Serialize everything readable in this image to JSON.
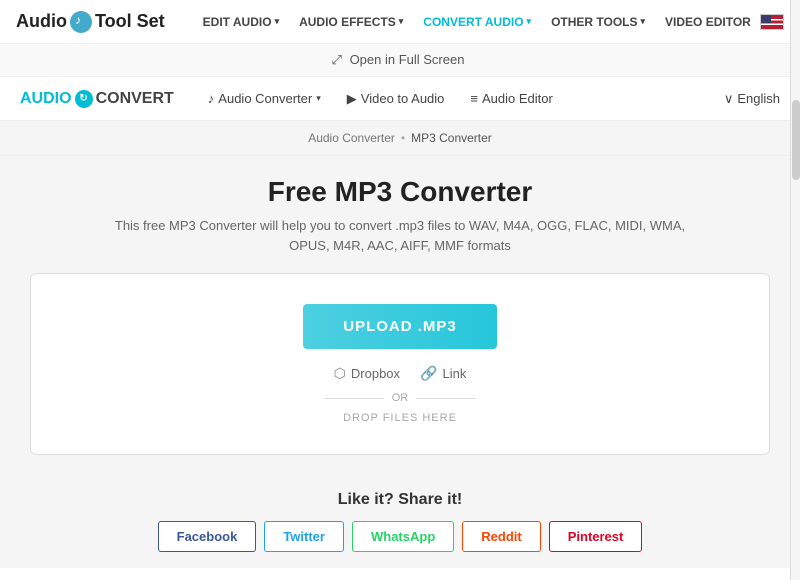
{
  "topNav": {
    "logo": "Audio Tool Set",
    "logoIconChar": "♪",
    "items": [
      {
        "label": "EDIT AUDIO",
        "hasDropdown": true,
        "active": false
      },
      {
        "label": "AUDIO EFFECTS",
        "hasDropdown": true,
        "active": false
      },
      {
        "label": "CONVERT AUDIO",
        "hasDropdown": true,
        "active": true
      },
      {
        "label": "OTHER TOOLS",
        "hasDropdown": true,
        "active": false
      },
      {
        "label": "VIDEO EDITOR",
        "hasDropdown": false,
        "active": false
      }
    ]
  },
  "fullscreenBar": {
    "icon": "⤢",
    "label": "Open in Full Screen"
  },
  "subNav": {
    "logoAudio": "AUDIO",
    "logoIconChar": "↻",
    "logoConvert": "CONVERT",
    "items": [
      {
        "label": "Audio Converter",
        "icon": "♪",
        "hasDropdown": true
      },
      {
        "label": "Video to Audio",
        "icon": "▶",
        "hasDropdown": false
      },
      {
        "label": "Audio Editor",
        "icon": "≡",
        "hasDropdown": false
      }
    ],
    "language": {
      "caret": "∨",
      "label": "English"
    }
  },
  "breadcrumb": {
    "parent": "Audio Converter",
    "separator": "•",
    "current": "MP3 Converter"
  },
  "mainContent": {
    "title": "Free MP3 Converter",
    "description": "This free MP3 Converter will help you to convert .mp3 files to WAV, M4A, OGG, FLAC, MIDI, WMA, OPUS, M4R, AAC, AIFF, MMF formats",
    "uploadBtn": "UPLOAD .MP3",
    "dropboxLabel": "Dropbox",
    "linkLabel": "Link",
    "orText": "OR",
    "dropText": "DROP FILES HERE"
  },
  "shareSection": {
    "title": "Like it? Share it!",
    "buttons": [
      {
        "label": "Facebook",
        "class": "facebook"
      },
      {
        "label": "Twitter",
        "class": "twitter"
      },
      {
        "label": "WhatsApp",
        "class": "whatsapp"
      },
      {
        "label": "Reddit",
        "class": "reddit"
      },
      {
        "label": "Pinterest",
        "class": "pinterest"
      }
    ]
  }
}
